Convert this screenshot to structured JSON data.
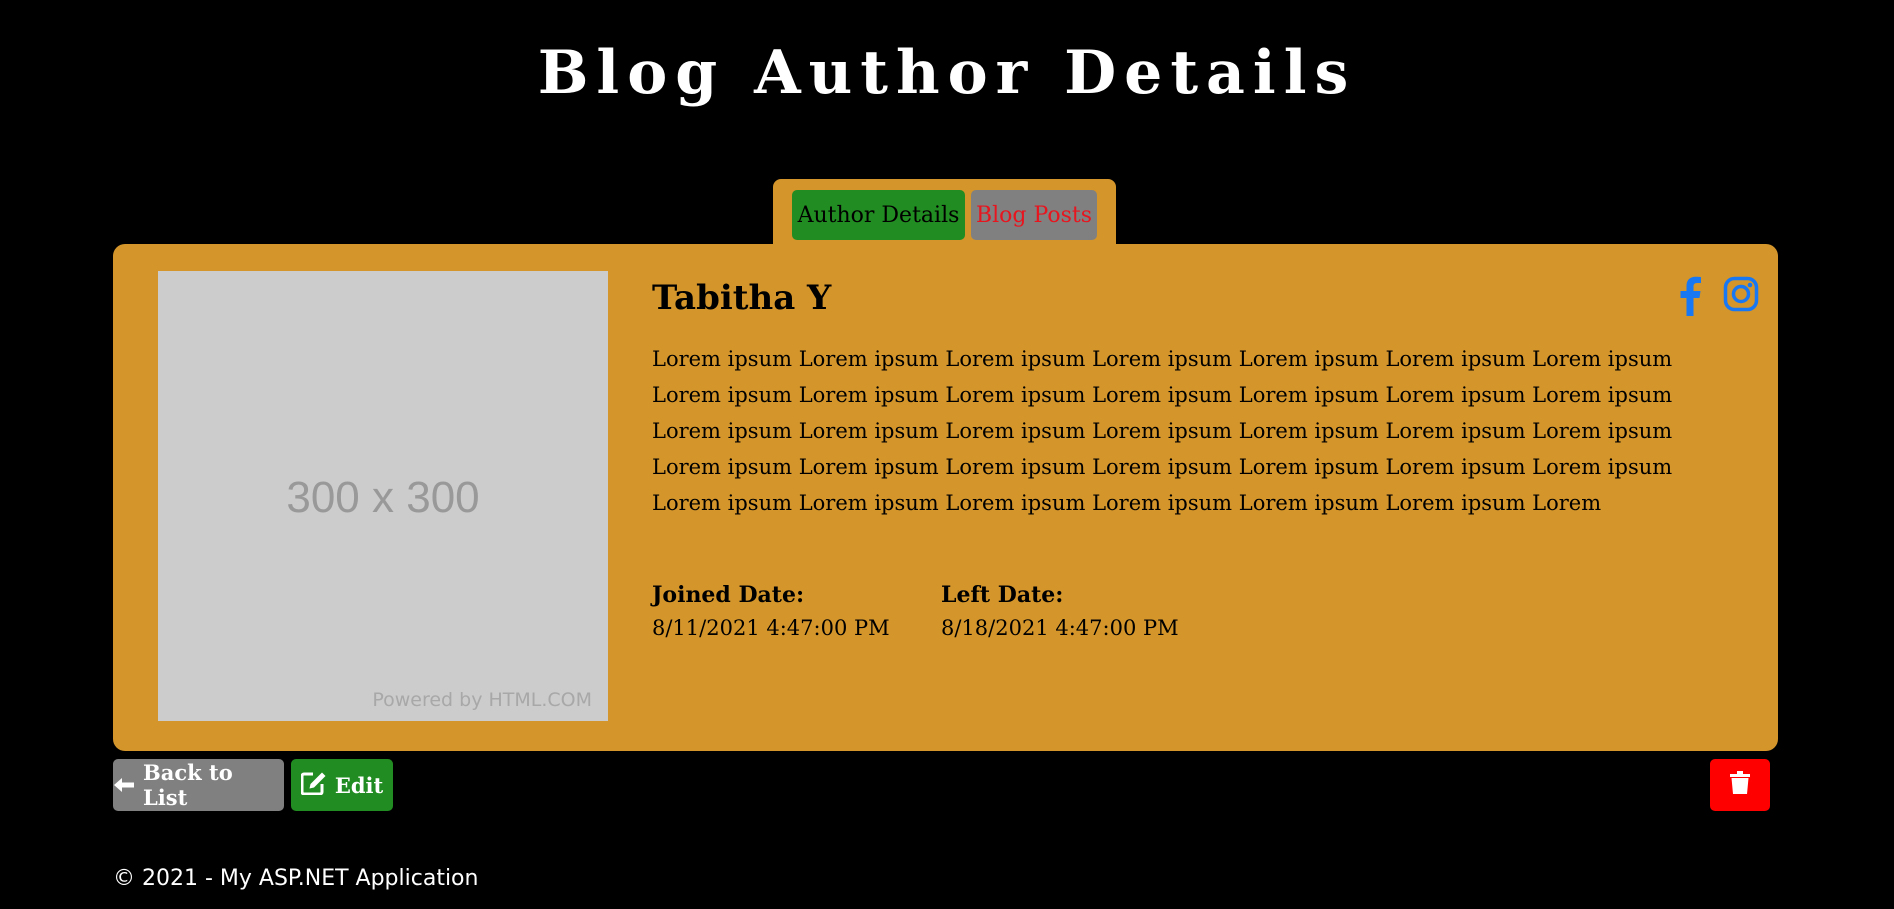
{
  "header": {
    "title": "Blog Author Details"
  },
  "tabs": [
    {
      "label": "Author Details",
      "active": true
    },
    {
      "label": "Blog Posts",
      "active": false
    }
  ],
  "author": {
    "image": {
      "size_text": "300 x 300",
      "powered_by": "Powered by HTML.COM"
    },
    "name": "Tabitha Y",
    "bio": "Lorem ipsum Lorem ipsum Lorem ipsum Lorem ipsum Lorem ipsum Lorem ipsum Lorem ipsum Lorem ipsum Lorem ipsum Lorem ipsum Lorem ipsum Lorem ipsum Lorem ipsum Lorem ipsum Lorem ipsum Lorem ipsum Lorem ipsum Lorem ipsum Lorem ipsum Lorem ipsum Lorem ipsum Lorem ipsum Lorem ipsum Lorem ipsum Lorem ipsum Lorem ipsum Lorem ipsum Lorem ipsum Lorem ipsum Lorem ipsum Lorem ipsum Lorem ipsum Lorem ipsum Lorem ipsum Lorem",
    "joined_label": "Joined Date:",
    "joined_value": "8/11/2021 4:47:00 PM",
    "left_label": "Left Date:",
    "left_value": "8/18/2021 4:47:00 PM",
    "social_icons": [
      "facebook-icon",
      "instagram-icon"
    ]
  },
  "actions": {
    "back_label": "Back to List",
    "edit_label": "Edit",
    "delete_icon": "trash-icon"
  },
  "footer": {
    "text": "© 2021 - My ASP.NET Application"
  },
  "colors": {
    "background": "#000000",
    "card": "#D4952B",
    "active_tab": "#218C21",
    "inactive_tab": "#808080",
    "inactive_tab_text": "#E8141E",
    "edit_button": "#218C21",
    "back_button": "#808080",
    "delete_button": "#FF0000",
    "social_icon": "#1877F2"
  }
}
